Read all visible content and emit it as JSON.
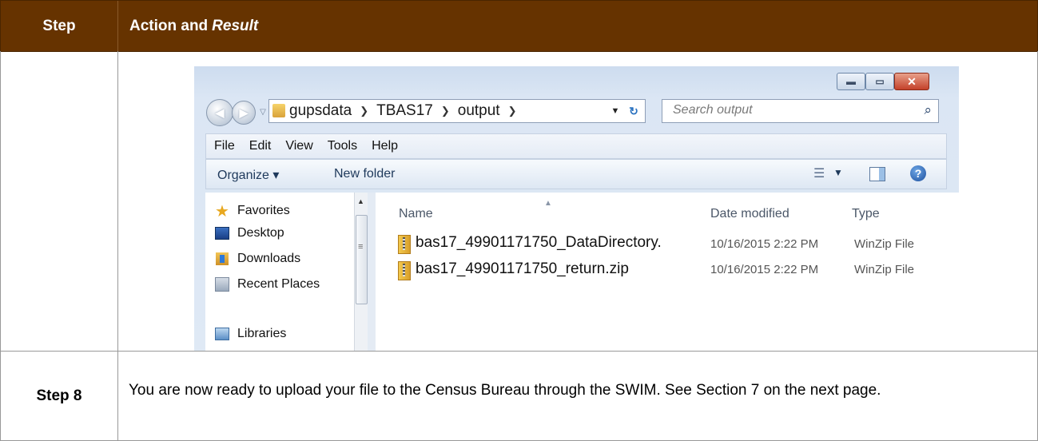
{
  "table": {
    "header_step": "Step",
    "header_action": "Action and",
    "header_result": "Result",
    "step8_label": "Step 8",
    "step8_text": "You are now ready to upload your file to the Census Bureau through the SWIM. See Section 7 on the next page."
  },
  "explorer": {
    "window_controls": [
      "minimize-icon",
      "maximize-icon",
      "close-icon"
    ],
    "address_crumbs": [
      "gupsdata",
      "TBAS17",
      "output"
    ],
    "search_placeholder": "Search output",
    "menu": [
      "File",
      "Edit",
      "View",
      "Tools",
      "Help"
    ],
    "toolbar": {
      "organize": "Organize ▾",
      "new_folder": "New folder"
    },
    "nav_items": [
      {
        "label": "Favorites",
        "icon": "star-icon"
      },
      {
        "label": "Desktop",
        "icon": "desktop-icon"
      },
      {
        "label": "Downloads",
        "icon": "downloads-folder-icon"
      },
      {
        "label": "Recent Places",
        "icon": "recent-places-icon"
      },
      {
        "label": "Libraries",
        "icon": "libraries-icon"
      }
    ],
    "columns": {
      "name": "Name",
      "date": "Date modified",
      "type": "Type"
    },
    "files": [
      {
        "name": "bas17_49901171750_DataDirectory.",
        "date": "10/16/2015 2:22 PM",
        "type": "WinZip File"
      },
      {
        "name": "bas17_49901171750_return.zip",
        "date": "10/16/2015 2:22 PM",
        "type": "WinZip File"
      }
    ]
  }
}
